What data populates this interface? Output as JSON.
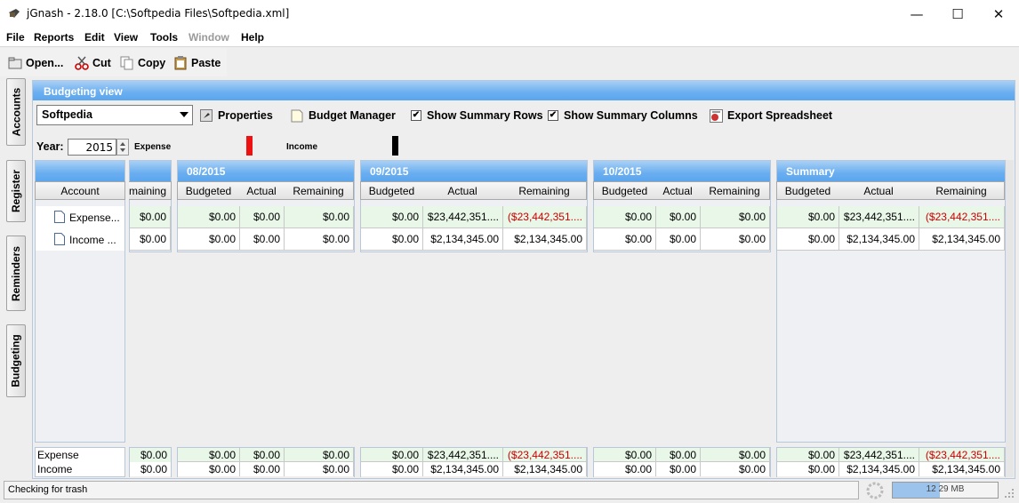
{
  "window": {
    "title": "jGnash - 2.18.0  [C:\\Softpedia Files\\Softpedia.xml]",
    "minimize": "—",
    "maximize": "☐",
    "close": "✕"
  },
  "menu": [
    "File",
    "Reports",
    "Edit",
    "View",
    "Tools",
    "Window",
    "Help"
  ],
  "toolbar": {
    "open": "Open...",
    "cut": "Cut",
    "copy": "Copy",
    "paste": "Paste"
  },
  "side_tabs": [
    "Accounts",
    "Register",
    "Reminders",
    "Budgeting"
  ],
  "budget": {
    "header": "Budgeting view",
    "selected": "Softpedia",
    "properties": "Properties",
    "manager": "Budget Manager",
    "show_summary_rows": "Show Summary Rows",
    "show_summary_columns": "Show Summary Columns",
    "export": "Export Spreadsheet",
    "year_label": "Year:",
    "year": "2015",
    "legend_expense": "Expense",
    "legend_income": "Income",
    "colors": {
      "expense": "#ee1111",
      "income": "#000000",
      "negative": "#cc0000",
      "header": "#6aaef0",
      "row_green": "#e8f7e8"
    }
  },
  "grid": {
    "account_header": "Account",
    "accounts": [
      "Expense...",
      "Income ..."
    ],
    "partial_col_header": "maining",
    "partial_values": [
      "$0.00",
      "$0.00"
    ],
    "partial_footer": [
      "$0.00",
      "$0.00"
    ],
    "periods": [
      {
        "label": "08/2015",
        "cols": [
          "Budgeted",
          "Actual",
          "Remaining"
        ],
        "rows": [
          [
            "$0.00",
            "$0.00",
            "$0.00"
          ],
          [
            "$0.00",
            "$0.00",
            "$0.00"
          ]
        ],
        "footer": [
          [
            "$0.00",
            "$0.00",
            "$0.00"
          ],
          [
            "$0.00",
            "$0.00",
            "$0.00"
          ]
        ]
      },
      {
        "label": "09/2015",
        "cols": [
          "Budgeted",
          "Actual",
          "Remaining"
        ],
        "rows": [
          [
            "$0.00",
            "$23,442,351....",
            "($23,442,351...."
          ],
          [
            "$0.00",
            "$2,134,345.00",
            "$2,134,345.00"
          ]
        ],
        "footer": [
          [
            "$0.00",
            "$23,442,351....",
            "($23,442,351...."
          ],
          [
            "$0.00",
            "$2,134,345.00",
            "$2,134,345.00"
          ]
        ]
      },
      {
        "label": "10/2015",
        "cols": [
          "Budgeted",
          "Actual",
          "Remaining"
        ],
        "rows": [
          [
            "$0.00",
            "$0.00",
            "$0.00"
          ],
          [
            "$0.00",
            "$0.00",
            "$0.00"
          ]
        ],
        "footer": [
          [
            "$0.00",
            "$0.00",
            "$0.00"
          ],
          [
            "$0.00",
            "$0.00",
            "$0.00"
          ]
        ]
      },
      {
        "label": "Summary",
        "cols": [
          "Budgeted",
          "Actual",
          "Remaining"
        ],
        "rows": [
          [
            "$0.00",
            "$23,442,351....",
            "($23,442,351...."
          ],
          [
            "$0.00",
            "$2,134,345.00",
            "$2,134,345.00"
          ]
        ],
        "footer": [
          [
            "$0.00",
            "$23,442,351....",
            "($23,442,351...."
          ],
          [
            "$0.00",
            "$2,134,345.00",
            "$2,134,345.00"
          ]
        ]
      }
    ],
    "footer_labels": [
      "Expense",
      "Income"
    ]
  },
  "status": {
    "text": "Checking for trash",
    "memory": "12 29 MB",
    "memory_used_fraction": 0.45
  }
}
